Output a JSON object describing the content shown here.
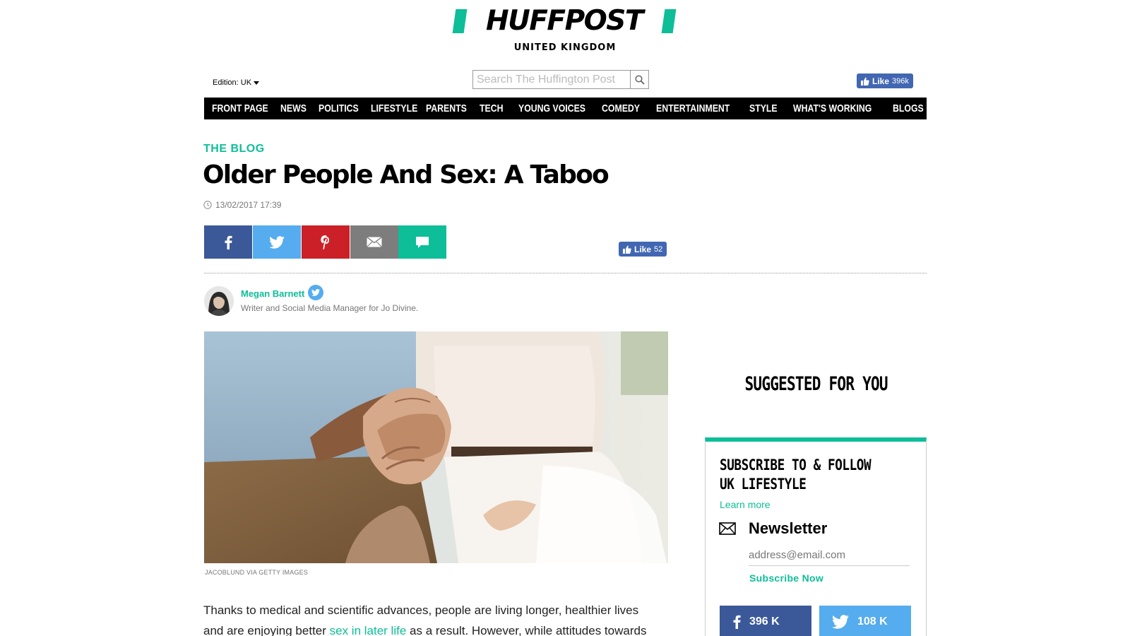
{
  "brand": {
    "name": "HUFFPOST",
    "edition_region": "UNITED KINGDOM",
    "accent_color": "#0dbe98"
  },
  "header": {
    "edition_label": "Edition: UK",
    "search_placeholder": "Search The Huffington Post",
    "fb_like_label": "Like",
    "fb_like_count": "396k"
  },
  "nav": {
    "items": [
      "FRONT PAGE",
      "NEWS",
      "POLITICS",
      "LIFESTYLE",
      "PARENTS",
      "TECH",
      "YOUNG VOICES",
      "COMEDY",
      "ENTERTAINMENT",
      "STYLE",
      "WHAT'S WORKING",
      "BLOGS"
    ]
  },
  "article": {
    "kicker": "THE BLOG",
    "title": "Older People And Sex: A Taboo",
    "timestamp": "13/02/2017 17:39",
    "share_icons": [
      "facebook-icon",
      "twitter-icon",
      "pinterest-icon",
      "email-icon",
      "comment-icon"
    ],
    "fb_like_label": "Like",
    "fb_like_count": "52",
    "author": {
      "name": "Megan Barnett",
      "bio": "Writer and Social Media Manager for Jo Divine."
    },
    "image_credit": "JACOBLUND VIA GETTY IMAGES",
    "body": {
      "line1": "Thanks to medical and scientific advances, people are living longer, healthier lives",
      "line2_before": "and are enjoying better ",
      "line2_link": "sex in later life",
      "line2_after": " as a result. However, while attitudes towards"
    }
  },
  "sidebar": {
    "suggested_heading": "SUGGESTED FOR YOU",
    "subscribe_line1": "SUBSCRIBE TO & FOLLOW",
    "subscribe_line2": "UK LIFESTYLE",
    "learn_more": "Learn more",
    "newsletter_title": "Newsletter",
    "email_placeholder": "address@email.com",
    "subscribe_now": "Subscribe Now",
    "facebook_count": "396 K",
    "twitter_count": "108 K"
  }
}
